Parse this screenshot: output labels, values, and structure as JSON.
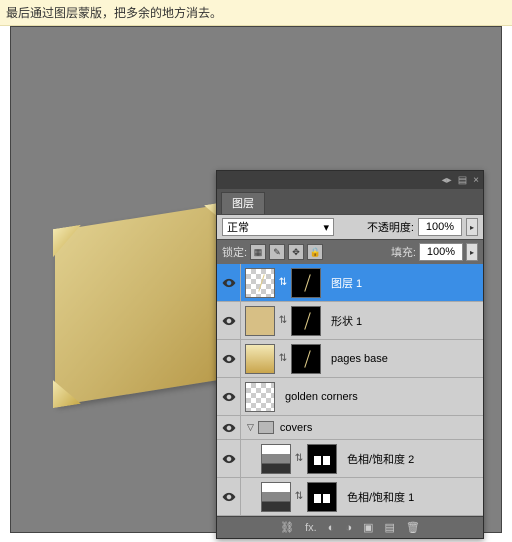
{
  "tip": "最后通过图层蒙版，把多余的地方消去。",
  "panel": {
    "tab": "图层",
    "blend_mode": "正常",
    "opacity_label": "不透明度:",
    "opacity_value": "100%",
    "lock_label": "锁定:",
    "fill_label": "填充:",
    "fill_value": "100%"
  },
  "layers": [
    {
      "name": "图层 1",
      "selected": true
    },
    {
      "name": "形状 1"
    },
    {
      "name": "pages base"
    },
    {
      "name": "golden corners"
    }
  ],
  "group": {
    "name": "covers"
  },
  "children": [
    {
      "name": "色相/饱和度 2"
    },
    {
      "name": "色相/饱和度 1"
    }
  ],
  "icons": {
    "menu": "▤",
    "collapse": "◂▸",
    "close": "×",
    "dropdown": "▾",
    "slider": "▸",
    "lock_trans": "▦",
    "lock_paint": "✎",
    "lock_move": "✥",
    "lock_all": "🔒",
    "tri": "▽",
    "link": "⇅",
    "fx": "fx.",
    "mask": "◐",
    "adjust": "◑",
    "folder": "▣",
    "new": "▤",
    "trash": "🗑",
    "chain": "⛓"
  }
}
